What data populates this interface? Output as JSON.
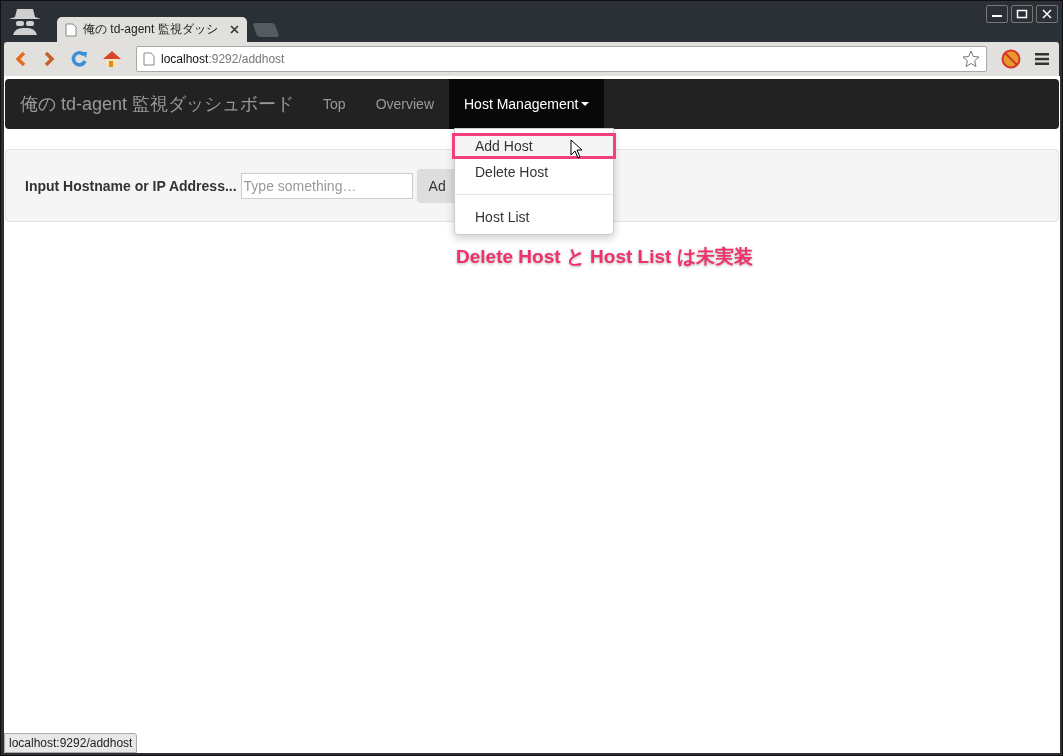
{
  "browser": {
    "tab_title": "俺の td-agent 監視ダッシ",
    "url_host": "localhost",
    "url_rest": ":9292/addhost",
    "status_text": "localhost:9292/addhost"
  },
  "navbar": {
    "brand": "俺の td-agent 監視ダッシュボード",
    "items": [
      {
        "label": "Top",
        "kind": "link",
        "selected": false
      },
      {
        "label": "Overview",
        "kind": "link",
        "selected": false
      },
      {
        "label": "Host Management",
        "kind": "dropdown",
        "selected": true
      }
    ]
  },
  "dropdown": {
    "groups": [
      [
        {
          "label": "Add Host",
          "selected": true
        },
        {
          "label": "Delete Host",
          "selected": false
        }
      ],
      [
        {
          "label": "Host List",
          "selected": false
        }
      ]
    ]
  },
  "form": {
    "label": "Input Hostname or IP Address...",
    "placeholder": "Type something…",
    "button": "Ad"
  },
  "annotation": "Delete Host と Host List は未実装"
}
